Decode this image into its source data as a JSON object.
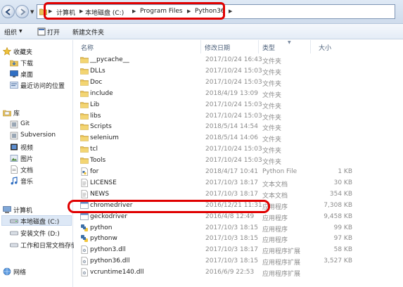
{
  "address_bar": {
    "crumbs": [
      "计算机",
      "本地磁盘 (C:)",
      "Program Files",
      "Python36"
    ]
  },
  "toolbar": {
    "organize_label": "组织",
    "open_label": "打开",
    "new_folder_label": "新建文件夹"
  },
  "nav_pane": {
    "favorites": "收藏夹",
    "favorites_items": [
      "下载",
      "桌面",
      "最近访问的位置"
    ],
    "libraries": "库",
    "library_items": [
      "Git",
      "Subversion",
      "视频",
      "图片",
      "文档",
      "音乐"
    ],
    "computer": "计算机",
    "computer_items": [
      "本地磁盘 (C:)",
      "安装文件 (D:)",
      "工作和日常文档存储"
    ],
    "network": "网络"
  },
  "columns": {
    "name": "名称",
    "date": "修改日期",
    "type": "类型",
    "size": "大小"
  },
  "files": [
    {
      "name": "__pycache__",
      "date": "2017/10/24 16:43",
      "type": "文件夹",
      "size": "",
      "icon": "folder"
    },
    {
      "name": "DLLs",
      "date": "2017/10/24 15:03",
      "type": "文件夹",
      "size": "",
      "icon": "folder"
    },
    {
      "name": "Doc",
      "date": "2017/10/24 15:03",
      "type": "文件夹",
      "size": "",
      "icon": "folder"
    },
    {
      "name": "include",
      "date": "2018/4/19 13:09",
      "type": "文件夹",
      "size": "",
      "icon": "folder"
    },
    {
      "name": "Lib",
      "date": "2017/10/24 15:03",
      "type": "文件夹",
      "size": "",
      "icon": "folder"
    },
    {
      "name": "libs",
      "date": "2017/10/24 15:03",
      "type": "文件夹",
      "size": "",
      "icon": "folder"
    },
    {
      "name": "Scripts",
      "date": "2018/5/14 14:54",
      "type": "文件夹",
      "size": "",
      "icon": "folder"
    },
    {
      "name": "selenium",
      "date": "2018/5/14 14:06",
      "type": "文件夹",
      "size": "",
      "icon": "folder"
    },
    {
      "name": "tcl",
      "date": "2017/10/24 15:03",
      "type": "文件夹",
      "size": "",
      "icon": "folder"
    },
    {
      "name": "Tools",
      "date": "2017/10/24 15:03",
      "type": "文件夹",
      "size": "",
      "icon": "folder"
    },
    {
      "name": "for",
      "date": "2018/4/17 10:41",
      "type": "Python File",
      "size": "1 KB",
      "icon": "python-file"
    },
    {
      "name": "LICENSE",
      "date": "2017/10/3 18:17",
      "type": "文本文档",
      "size": "30 KB",
      "icon": "text-file"
    },
    {
      "name": "NEWS",
      "date": "2017/10/3 18:17",
      "type": "文本文档",
      "size": "354 KB",
      "icon": "text-file"
    },
    {
      "name": "chromedriver",
      "date": "2016/12/21 11:31",
      "type": "应用程序",
      "size": "7,308 KB",
      "icon": "exe"
    },
    {
      "name": "geckodriver",
      "date": "2016/4/8 12:49",
      "type": "应用程序",
      "size": "9,458 KB",
      "icon": "exe"
    },
    {
      "name": "python",
      "date": "2017/10/3 18:15",
      "type": "应用程序",
      "size": "99 KB",
      "icon": "python-exe"
    },
    {
      "name": "pythonw",
      "date": "2017/10/3 18:15",
      "type": "应用程序",
      "size": "97 KB",
      "icon": "python-exe"
    },
    {
      "name": "python3.dll",
      "date": "2017/10/3 18:17",
      "type": "应用程序扩展",
      "size": "58 KB",
      "icon": "dll"
    },
    {
      "name": "python36.dll",
      "date": "2017/10/3 18:15",
      "type": "应用程序扩展",
      "size": "3,527 KB",
      "icon": "dll"
    },
    {
      "name": "vcruntime140.dll",
      "date": "2016/6/9 22:53",
      "type": "应用程序扩展",
      "size": "",
      "icon": "dll"
    }
  ],
  "colors": {
    "highlight": "#e00000",
    "folder": "#e8c35a"
  }
}
